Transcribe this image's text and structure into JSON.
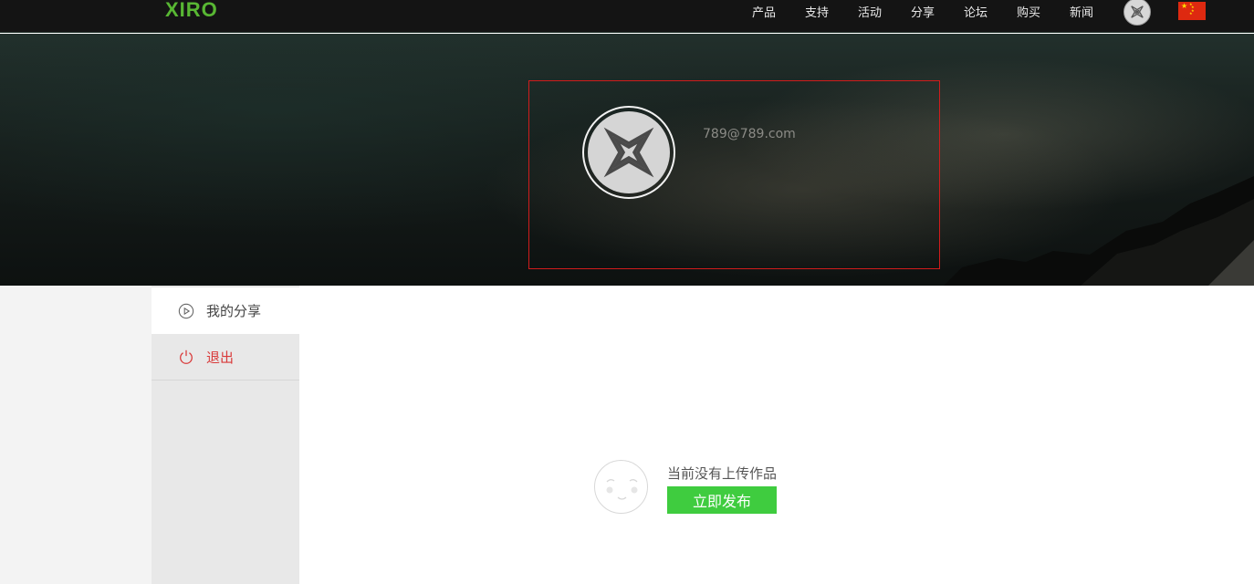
{
  "header": {
    "logo": "XIRO",
    "nav": [
      {
        "label": "产品"
      },
      {
        "label": "支持"
      },
      {
        "label": "活动"
      },
      {
        "label": "分享"
      },
      {
        "label": "论坛"
      },
      {
        "label": "购买"
      },
      {
        "label": "新闻"
      }
    ],
    "avatar_icon": "xiro-drone-icon",
    "language_icon": "china-flag-icon"
  },
  "profile": {
    "email": "789@789.com",
    "avatar_icon": "xiro-drone-icon"
  },
  "sidebar": {
    "items": [
      {
        "label": "我的分享",
        "icon": "play-circle-icon"
      },
      {
        "label": "退出",
        "icon": "power-icon"
      }
    ]
  },
  "empty_state": {
    "message": "当前没有上传作品",
    "button_label": "立即发布",
    "icon": "smiley-face-icon"
  },
  "colors": {
    "brand_green": "#58b733",
    "button_green": "#3fcc3f",
    "logout_red": "#d93a3a",
    "highlight_border": "#d01c1c"
  }
}
